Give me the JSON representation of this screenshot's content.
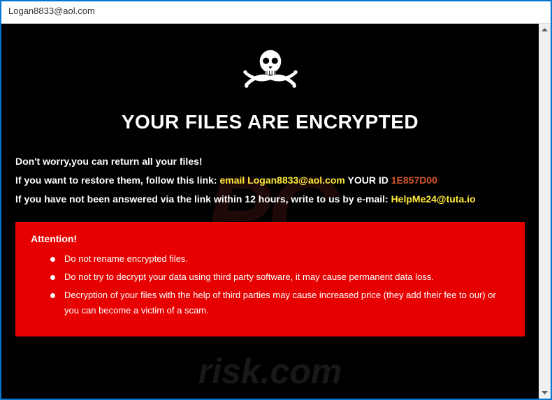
{
  "window": {
    "title": "Logan8833@aol.com"
  },
  "header": {
    "title": "YOUR FILES ARE ENCRYPTED"
  },
  "messages": {
    "line1": "Don't worry,you can return all your files!",
    "line2_prefix": "If you want to restore them, follow this link: ",
    "line2_email_label": "email ",
    "line2_email": "Logan8833@aol.com",
    "line2_id_label": "  YOUR ID ",
    "line2_id": "1E857D00",
    "line3_prefix": "If you have not been answered via the link within 12 hours, write to us by e-mail: ",
    "line3_email": "HelpMe24@tuta.io"
  },
  "attention": {
    "title": "Attention!",
    "items": [
      "Do not rename encrypted files.",
      "Do not try to decrypt your data using third party software, it may cause permanent data loss.",
      "Decryption of your files with the help of third parties may cause increased price (they add their fee to our) or you can become a victim of a scam."
    ]
  },
  "watermark": {
    "main": "PC",
    "sub": "risk.com"
  }
}
